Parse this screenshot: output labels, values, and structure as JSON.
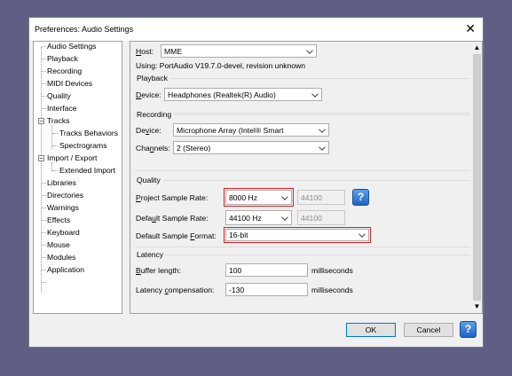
{
  "window": {
    "title": "Preferences: Audio Settings",
    "close_glyph": "✕"
  },
  "tree": {
    "items": [
      {
        "label": "Audio Settings"
      },
      {
        "label": "Playback"
      },
      {
        "label": "Recording"
      },
      {
        "label": "MIDI Devices"
      },
      {
        "label": "Quality"
      },
      {
        "label": "Interface"
      },
      {
        "label": "Tracks"
      },
      {
        "label": "Tracks Behaviors"
      },
      {
        "label": "Spectrograms"
      },
      {
        "label": "Import / Export"
      },
      {
        "label": "Extended Import"
      },
      {
        "label": "Libraries"
      },
      {
        "label": "Directories"
      },
      {
        "label": "Warnings"
      },
      {
        "label": "Effects"
      },
      {
        "label": "Keyboard"
      },
      {
        "label": "Mouse"
      },
      {
        "label": "Modules"
      },
      {
        "label": "Application"
      }
    ]
  },
  "host": {
    "label_u": "H",
    "label_rest": "ost:",
    "value": "MME",
    "using": "Using: PortAudio V19.7.0-devel, revision unknown"
  },
  "playback": {
    "title": "Playback",
    "device_label_u": "D",
    "device_label_rest": "evice:",
    "device_value": "Headphones (Realtek(R) Audio)"
  },
  "recording": {
    "title": "Recording",
    "device_label_a": "De",
    "device_label_u": "v",
    "device_label_b": "ice:",
    "device_value": "Microphone Array (Intel® Smart",
    "channels_label_a": "Cha",
    "channels_label_u": "n",
    "channels_label_b": "nels:",
    "channels_value": "2 (Stereo)"
  },
  "quality": {
    "title": "Quality",
    "project_rate_label_u": "P",
    "project_rate_label_rest": "roject Sample Rate:",
    "project_rate_value": "8000 Hz",
    "project_rate_custom": "44100",
    "default_rate_label_a": "Defa",
    "default_rate_label_u": "u",
    "default_rate_label_b": "lt Sample Rate:",
    "default_rate_value": "44100 Hz",
    "default_rate_custom": "44100",
    "default_format_label_a": "Default Sample ",
    "default_format_label_u": "F",
    "default_format_label_b": "ormat:",
    "default_format_value": "16-bit",
    "help_glyph": "?"
  },
  "latency": {
    "title": "Latency",
    "buffer_label_u": "B",
    "buffer_label_rest": "uffer length:",
    "buffer_value": "100",
    "buffer_unit": "milliseconds",
    "comp_label_a": "Latency ",
    "comp_label_u": "c",
    "comp_label_b": "ompensation:",
    "comp_value": "-130",
    "comp_unit": "milliseconds"
  },
  "buttons": {
    "ok": "OK",
    "cancel": "Cancel",
    "help": "?"
  },
  "scroll": {
    "up": "▲",
    "down": "▼"
  },
  "colors": {
    "accent": "#0078d7",
    "highlight": "#d42020",
    "help": "#1f63c6",
    "backdrop": "#5f5f85"
  }
}
